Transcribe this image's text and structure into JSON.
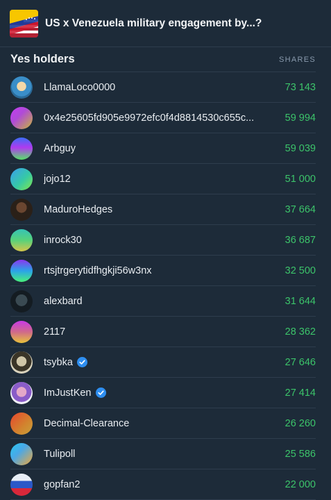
{
  "market": {
    "title": "US x Venezuela military engagement by...?",
    "flag_icon": "us-venezuela-flag-icon"
  },
  "section": {
    "title": "Yes holders",
    "column_label": "SHARES"
  },
  "colors": {
    "background": "#1d2b39",
    "divider": "#2e3d4d",
    "shares_green": "#3cc46a",
    "verified_blue": "#2e8ef0"
  },
  "holders": [
    {
      "name": "LlamaLoco0000",
      "shares": "73 143",
      "verified": false,
      "avatar": "pixel-art-avatar"
    },
    {
      "name": "0x4e25605fd905e9972efc0f4d8814530c655c...",
      "shares": "59 994",
      "verified": false,
      "avatar": "gradient-avatar"
    },
    {
      "name": "Arbguy",
      "shares": "59 039",
      "verified": false,
      "avatar": "gradient-avatar"
    },
    {
      "name": "jojo12",
      "shares": "51 000",
      "verified": false,
      "avatar": "gradient-avatar"
    },
    {
      "name": "MaduroHedges",
      "shares": "37 664",
      "verified": false,
      "avatar": "photo-avatar"
    },
    {
      "name": "inrock30",
      "shares": "36 687",
      "verified": false,
      "avatar": "gradient-avatar"
    },
    {
      "name": "rtsjtrgerytidfhgkji56w3nx",
      "shares": "32 500",
      "verified": false,
      "avatar": "gradient-avatar"
    },
    {
      "name": "alexbard",
      "shares": "31 644",
      "verified": false,
      "avatar": "photo-avatar"
    },
    {
      "name": "2117",
      "shares": "28 362",
      "verified": false,
      "avatar": "gradient-avatar"
    },
    {
      "name": "tsybka",
      "shares": "27 646",
      "verified": true,
      "avatar": "photo-avatar"
    },
    {
      "name": "ImJustKen",
      "shares": "27 414",
      "verified": true,
      "avatar": "photo-avatar"
    },
    {
      "name": "Decimal-Clearance",
      "shares": "26 260",
      "verified": false,
      "avatar": "gradient-avatar"
    },
    {
      "name": "Tulipoll",
      "shares": "25 586",
      "verified": false,
      "avatar": "gradient-avatar"
    },
    {
      "name": "gopfan2",
      "shares": "22 000",
      "verified": false,
      "avatar": "flag-avatar"
    }
  ]
}
